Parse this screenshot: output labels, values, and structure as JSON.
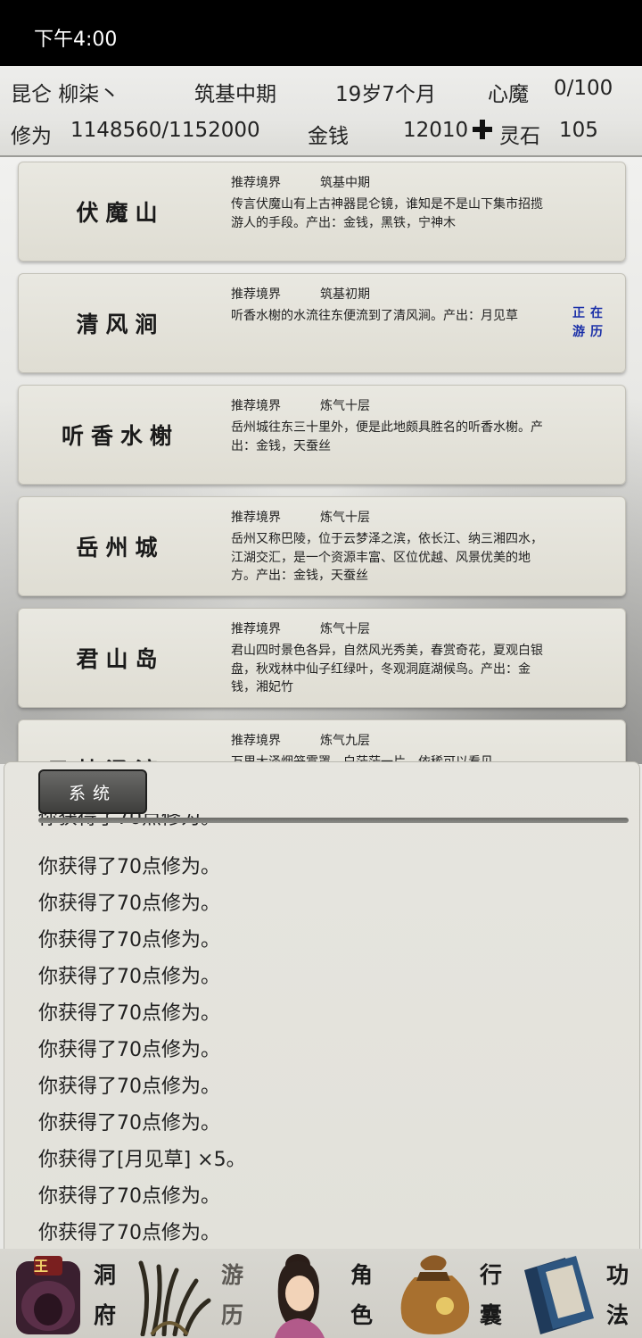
{
  "status_bar": {
    "time": "下午4:00"
  },
  "header": {
    "sect_name": "昆仑 柳柒丶",
    "realm": "筑基中期",
    "age": "19岁7个月",
    "heart_demon_label": "心魔",
    "heart_demon_value": "0/100",
    "cultivation_label": "修为",
    "cultivation_value": "1148560/1152000",
    "money_label": "金钱",
    "money_value": "12010",
    "spirit_stone_label": "灵石",
    "spirit_stone_value": "105"
  },
  "locations": [
    {
      "name": "伏魔山",
      "realm_label": "推荐境界",
      "realm": "筑基中期",
      "description": "传言伏魔山有上古神器昆仑镜，谁知是不是山下集市招揽游人的手段。产出：金钱，黑铁，宁神木",
      "status": ""
    },
    {
      "name": "清风涧",
      "realm_label": "推荐境界",
      "realm": "筑基初期",
      "description": "听香水榭的水流往东便流到了清风涧。产出：月见草",
      "status": "正在游历"
    },
    {
      "name": "听香水榭",
      "realm_label": "推荐境界",
      "realm": "炼气十层",
      "description": "岳州城往东三十里外，便是此地颇具胜名的听香水榭。产出：金钱，天蚕丝",
      "status": ""
    },
    {
      "name": "岳州城",
      "realm_label": "推荐境界",
      "realm": "炼气十层",
      "description": "岳州又称巴陵，位于云梦泽之滨，依长江、纳三湘四水，江湖交汇，是一个资源丰富、区位优越、风景优美的地方。产出：金钱，天蚕丝",
      "status": ""
    },
    {
      "name": "君山岛",
      "realm_label": "推荐境界",
      "realm": "炼气十层",
      "description": "君山四时景色各异，自然风光秀美，春赏奇花，夏观白银盘，秋戏林中仙子红绿叶，冬观洞庭湖候鸟。产出：金钱，湘妃竹",
      "status": ""
    },
    {
      "name": "云梦泽渡口",
      "realm_label": "推荐境界",
      "realm": "炼气九层",
      "description": "万里大泽烟笼雾罩，白茫茫一片，依稀可以看见",
      "status": ""
    }
  ],
  "log": {
    "tab_label": "系统",
    "lines": [
      "你获得了70点修为。",
      "你获得了70点修为。",
      "你获得了70点修为。",
      "你获得了70点修为。",
      "你获得了70点修为。",
      "你获得了70点修为。",
      "你获得了70点修为。",
      "你获得了70点修为。",
      "你获得了70点修为。",
      "你获得了[月见草] ×5。",
      "你获得了70点修为。",
      "你获得了70点修为。"
    ]
  },
  "nav": {
    "cave": {
      "c1": "洞",
      "c2": "府"
    },
    "travel": {
      "c1": "游",
      "c2": "历"
    },
    "role": {
      "c1": "角",
      "c2": "色"
    },
    "bag": {
      "c1": "行",
      "c2": "囊"
    },
    "skills": {
      "c1": "功",
      "c2": "法"
    },
    "cave_badge": "王"
  },
  "colors": {
    "traveling_text": "#1a2fa8",
    "status_bar_bg": "#000000"
  }
}
